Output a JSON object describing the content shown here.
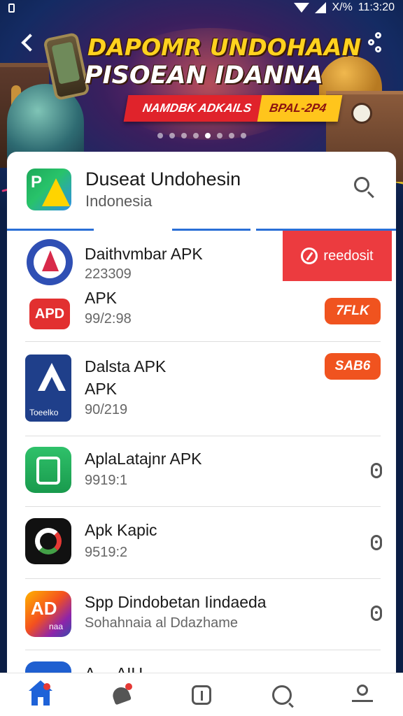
{
  "status_bar": {
    "time": "11:3:20",
    "battery_text": "X/%"
  },
  "banner": {
    "title_line1": "DAPOMR UNDOHAAN",
    "title_line2": "PISOEAN IDANNA",
    "ribbon_red": "NAMDBK ADKAILS",
    "ribbon_yellow": "BPAL-2P4",
    "dots_count": 8,
    "active_dot": 4
  },
  "app_header": {
    "logo_text": "P",
    "name": "Duseat Undohesin",
    "region": "Indonesia"
  },
  "list": [
    {
      "title": "Daithvmbar APK",
      "subtitle": "223309",
      "action": "reedosit"
    },
    {
      "title": "APK",
      "subtitle": "99/2:98",
      "icon_text": "APD",
      "action": "7FLK"
    },
    {
      "title": "Dalsta APK",
      "title2": "APK",
      "subtitle": "90/219",
      "icon_label": "Toeelko",
      "action": "SAB6"
    },
    {
      "title": "AplaLatajnr APK",
      "subtitle": "9919:1"
    },
    {
      "title": "Apk Kapic",
      "subtitle": "9519:2"
    },
    {
      "title": "Spp Dindobetan Iindaeda",
      "subtitle": "Sohahnaia   al  Ddazhame",
      "icon_text": "AD",
      "icon_label": "naa"
    },
    {
      "title": "A ... AIU ..."
    }
  ],
  "colors": {
    "accent": "#2a6fd6",
    "deposit": "#ec3b3f",
    "pill": "#f0531f",
    "nav_active": "#1e62d8"
  },
  "bottom_nav": [
    "home-icon",
    "bell-icon",
    "info-icon",
    "chat-icon",
    "profile-icon"
  ]
}
